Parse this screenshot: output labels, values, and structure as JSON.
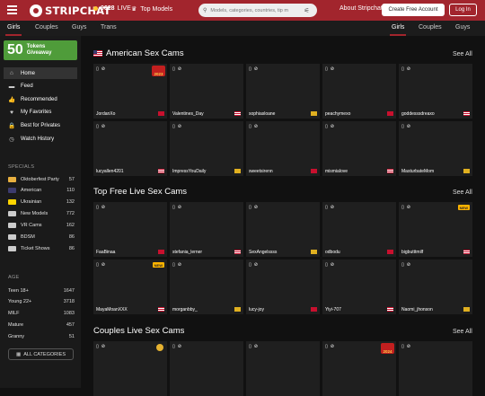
{
  "header": {
    "logo_text": "STRIPCHAT",
    "live_count": "9628",
    "live_label": "LIVE",
    "top_models": "Top Models",
    "search_placeholder": "Models, categories, countries, tip m",
    "about": "About Stripchat",
    "create_account": "Create Free Account",
    "login": "Log In"
  },
  "subnav": {
    "left_tabs": [
      "Girls",
      "Couples",
      "Guys",
      "Trans"
    ],
    "right_tabs": [
      "Girls",
      "Couples",
      "Guys"
    ]
  },
  "sidebar": {
    "promo_number": "50",
    "promo_line1": "Tokens",
    "promo_line2": "Giveaway",
    "nav": [
      {
        "label": "Home",
        "icon": "home-icon",
        "glyph": "⌂"
      },
      {
        "label": "Feed",
        "icon": "feed-icon",
        "glyph": "▬"
      },
      {
        "label": "Recommended",
        "icon": "thumbs-up-icon",
        "glyph": "👍"
      },
      {
        "label": "My Favorites",
        "icon": "heart-icon",
        "glyph": "♥"
      },
      {
        "label": "Best for Privates",
        "icon": "lock-icon",
        "glyph": "🔒"
      },
      {
        "label": "Watch History",
        "icon": "history-icon",
        "glyph": "◷"
      }
    ],
    "specials_title": "SPECIALS",
    "specials": [
      {
        "label": "Oktoberfest Party",
        "count": "57",
        "color": "#e8b040"
      },
      {
        "label": "American",
        "count": "110",
        "color": "#3c3b6e"
      },
      {
        "label": "Ukrainian",
        "count": "132",
        "color": "#ffd500"
      },
      {
        "label": "New Models",
        "count": "772",
        "color": "#cccccc"
      },
      {
        "label": "VR Cams",
        "count": "162",
        "color": "#cccccc"
      },
      {
        "label": "BDSM",
        "count": "86",
        "color": "#cccccc"
      },
      {
        "label": "Ticket Shows",
        "count": "86",
        "color": "#cccccc"
      }
    ],
    "age_title": "AGE",
    "age": [
      {
        "label": "Teen 18+",
        "count": "1647"
      },
      {
        "label": "Young 22+",
        "count": "3718"
      },
      {
        "label": "MILF",
        "count": "1083"
      },
      {
        "label": "Mature",
        "count": "457"
      },
      {
        "label": "Granny",
        "count": "51"
      }
    ],
    "all_categories": "ALL CATEGORIES"
  },
  "sections": [
    {
      "title": "American Sex Cams",
      "see_all": "See All",
      "rows": [
        [
          {
            "name": "JordanXo",
            "badge": "2023"
          },
          {
            "name": "Valentines_Day"
          },
          {
            "name": "sophiasloane"
          },
          {
            "name": "peachymexo"
          },
          {
            "name": "goddesssdreaxo"
          }
        ],
        [
          {
            "name": "lucyallen4201"
          },
          {
            "name": "ImpressYouDaily"
          },
          {
            "name": "sweetsirenn"
          },
          {
            "name": "mismialove"
          },
          {
            "name": "MasturbateMom"
          }
        ]
      ]
    },
    {
      "title": "Top Free Live Sex Cams",
      "see_all": "See All",
      "rows": [
        [
          {
            "name": "FaaBinaa"
          },
          {
            "name": "stefania_lerner"
          },
          {
            "name": "SexAngelssss"
          },
          {
            "name": "odbodu"
          },
          {
            "name": "bigbutttmilf",
            "badge": "NEW"
          }
        ],
        [
          {
            "name": "MayaMoanXXX",
            "badge": "NEW"
          },
          {
            "name": "morganbby_"
          },
          {
            "name": "lucy-joy"
          },
          {
            "name": "Yiyi-707"
          },
          {
            "name": "Naomi_jhonson"
          }
        ]
      ]
    },
    {
      "title": "Couples Live Sex Cams",
      "see_all": "See All",
      "rows": [
        [
          {
            "name": "",
            "badge": "trophy"
          },
          {
            "name": ""
          },
          {
            "name": ""
          },
          {
            "name": "",
            "badge": "2024"
          },
          {
            "name": ""
          }
        ]
      ]
    }
  ]
}
